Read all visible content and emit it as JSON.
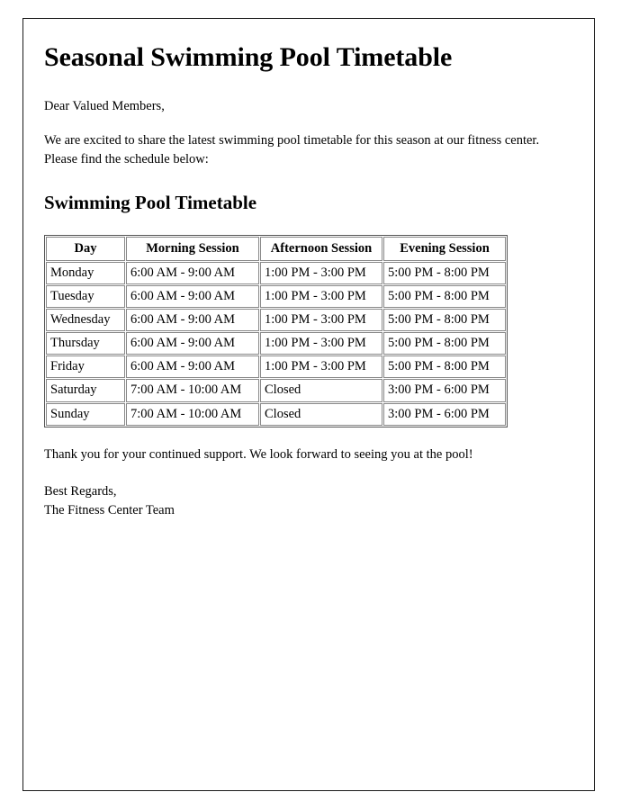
{
  "document": {
    "title": "Seasonal Swimming Pool Timetable",
    "salutation": "Dear Valued Members,",
    "intro_paragraph": "We are excited to share the latest swimming pool timetable for this season at our fitness center. Please find the schedule below:",
    "section_heading": "Swimming Pool Timetable",
    "closing_paragraph": "Thank you for your continued support. We look forward to seeing you at the pool!",
    "signoff_line1": "Best Regards,",
    "signoff_line2": "The Fitness Center Team"
  },
  "timetable": {
    "headers": [
      "Day",
      "Morning Session",
      "Afternoon Session",
      "Evening Session"
    ],
    "rows": [
      {
        "day": "Monday",
        "morning": "6:00 AM - 9:00 AM",
        "afternoon": "1:00 PM - 3:00 PM",
        "evening": "5:00 PM - 8:00 PM"
      },
      {
        "day": "Tuesday",
        "morning": "6:00 AM - 9:00 AM",
        "afternoon": "1:00 PM - 3:00 PM",
        "evening": "5:00 PM - 8:00 PM"
      },
      {
        "day": "Wednesday",
        "morning": "6:00 AM - 9:00 AM",
        "afternoon": "1:00 PM - 3:00 PM",
        "evening": "5:00 PM - 8:00 PM"
      },
      {
        "day": "Thursday",
        "morning": "6:00 AM - 9:00 AM",
        "afternoon": "1:00 PM - 3:00 PM",
        "evening": "5:00 PM - 8:00 PM"
      },
      {
        "day": "Friday",
        "morning": "6:00 AM - 9:00 AM",
        "afternoon": "1:00 PM - 3:00 PM",
        "evening": "5:00 PM - 8:00 PM"
      },
      {
        "day": "Saturday",
        "morning": "7:00 AM - 10:00 AM",
        "afternoon": "Closed",
        "evening": "3:00 PM - 6:00 PM"
      },
      {
        "day": "Sunday",
        "morning": "7:00 AM - 10:00 AM",
        "afternoon": "Closed",
        "evening": "3:00 PM - 6:00 PM"
      }
    ]
  },
  "colors": {
    "page_background": "#ffffff",
    "text": "#000000",
    "page_border": "#1a1a1a",
    "table_outer_border": "#555555",
    "table_cell_border": "#888888"
  }
}
